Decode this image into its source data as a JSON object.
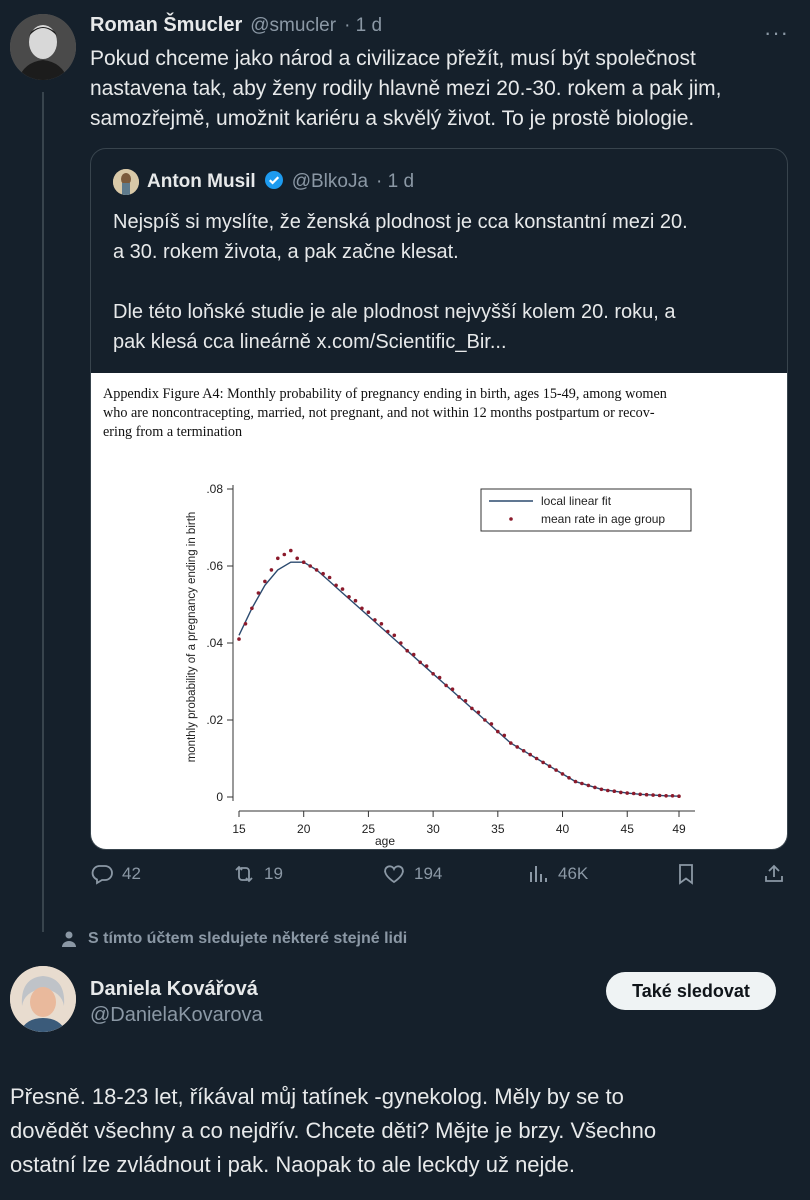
{
  "main_tweet": {
    "name": "Roman Šmucler",
    "handle": "@smucler",
    "time": "· 1 d",
    "text_lines": [
      "Pokud chceme jako národ a civilizace přežít, musí být společnost",
      "nastavena tak, aby ženy rodily hlavně mezi 20.-30. rokem a pak jim,",
      "samozřejmě, umožnit kariéru a skvělý život. To je prostě biologie."
    ],
    "more": "···"
  },
  "quote": {
    "name": "Anton Musil",
    "handle": "@BlkoJa",
    "time": "· 1 d",
    "para1": [
      "Nejspíš si myslíte, že ženská plodnost je cca konstantní mezi 20.",
      "a 30. rokem života, a pak začne klesat."
    ],
    "para2": [
      "Dle této loňské studie je ale plodnost nejvyšší kolem 20. roku, a",
      "pak klesá cca lineárně x.com/Scientific_Bir..."
    ]
  },
  "figure": {
    "caption_lines": [
      "Appendix Figure A4: Monthly probability of pregnancy ending in birth, ages 15-49, among women",
      "who are noncontracepting, married, not pregnant, and not within 12 months postpartum or recov-",
      "ering from a termination"
    ]
  },
  "chart_data": {
    "type": "scatter",
    "xlabel": "age",
    "ylabel": "monthly probability of a pregnancy ending in birth",
    "xlim": [
      15,
      49
    ],
    "ylim": [
      0,
      0.08
    ],
    "x_ticks": [
      "15",
      "20",
      "25",
      "30",
      "35",
      "40",
      "45",
      "49"
    ],
    "y_ticks": [
      "0",
      ".02",
      ".04",
      ".06",
      ".08"
    ],
    "legend_position": "top-right",
    "series": [
      {
        "name": "local linear fit",
        "style": "line",
        "color": "#2b4a6f",
        "x": [
          15,
          16,
          17,
          18,
          19,
          20,
          21,
          22,
          23,
          24,
          25,
          26,
          27,
          28,
          29,
          30,
          31,
          32,
          33,
          34,
          35,
          36,
          37,
          38,
          39,
          40,
          41,
          42,
          43,
          44,
          45,
          46,
          47,
          48,
          49
        ],
        "y": [
          0.042,
          0.049,
          0.055,
          0.059,
          0.061,
          0.061,
          0.059,
          0.056,
          0.053,
          0.05,
          0.047,
          0.044,
          0.041,
          0.038,
          0.035,
          0.032,
          0.029,
          0.026,
          0.023,
          0.02,
          0.017,
          0.014,
          0.012,
          0.01,
          0.008,
          0.006,
          0.004,
          0.003,
          0.002,
          0.0015,
          0.001,
          0.0007,
          0.0005,
          0.0003,
          0.0002
        ]
      },
      {
        "name": "mean rate in age group",
        "style": "points",
        "color": "#8b1a2b",
        "x": [
          15,
          15.5,
          16,
          16.5,
          17,
          17.5,
          18,
          18.5,
          19,
          19.5,
          20,
          20.5,
          21,
          21.5,
          22,
          22.5,
          23,
          23.5,
          24,
          24.5,
          25,
          25.5,
          26,
          26.5,
          27,
          27.5,
          28,
          28.5,
          29,
          29.5,
          30,
          30.5,
          31,
          31.5,
          32,
          32.5,
          33,
          33.5,
          34,
          34.5,
          35,
          35.5,
          36,
          36.5,
          37,
          37.5,
          38,
          38.5,
          39,
          39.5,
          40,
          40.5,
          41,
          41.5,
          42,
          42.5,
          43,
          43.5,
          44,
          44.5,
          45,
          45.5,
          46,
          46.5,
          47,
          47.5,
          48,
          48.5,
          49
        ],
        "y": [
          0.041,
          0.045,
          0.049,
          0.053,
          0.056,
          0.059,
          0.062,
          0.063,
          0.064,
          0.062,
          0.061,
          0.06,
          0.059,
          0.058,
          0.057,
          0.055,
          0.054,
          0.052,
          0.051,
          0.049,
          0.048,
          0.046,
          0.045,
          0.043,
          0.042,
          0.04,
          0.038,
          0.037,
          0.035,
          0.034,
          0.032,
          0.031,
          0.029,
          0.028,
          0.026,
          0.025,
          0.023,
          0.022,
          0.02,
          0.019,
          0.017,
          0.016,
          0.014,
          0.013,
          0.012,
          0.011,
          0.01,
          0.009,
          0.008,
          0.007,
          0.006,
          0.005,
          0.004,
          0.0035,
          0.003,
          0.0025,
          0.002,
          0.0017,
          0.0015,
          0.0012,
          0.001,
          0.0009,
          0.0007,
          0.0006,
          0.0005,
          0.0004,
          0.0003,
          0.0003,
          0.0002
        ]
      }
    ]
  },
  "actions": {
    "replies": "42",
    "retweets": "19",
    "likes": "194",
    "views": "46K"
  },
  "social_context": "S tímto účtem sledujete některé stejné lidi",
  "reply_user": {
    "name": "Daniela Kovářová",
    "handle": "@DanielaKovarova",
    "follow_label": "Také sledovat"
  },
  "reply_text_lines": [
    "Přesně. 18-23 let, říkával můj tatínek -gynekolog. Měly by se to",
    "dovědět všechny a co nejdřív. Chcete děti? Mějte je brzy. Všechno",
    "ostatní lze zvládnout i pak. Naopak to ale leckdy už nejde."
  ],
  "colors": {
    "background": "#15202b",
    "verified": "#1d9bf0",
    "scatter": "#8b1a2b",
    "fit": "#2b4a6f"
  }
}
